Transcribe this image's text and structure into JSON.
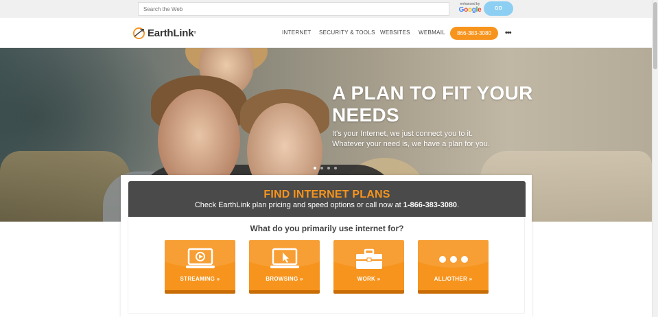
{
  "search": {
    "placeholder": "Search the Web",
    "enhanced_by": "enhanced by",
    "google": "Google",
    "go_label": "GO"
  },
  "nav": {
    "logo_text": "EarthLink",
    "links": [
      "INTERNET",
      "SECURITY & TOOLS",
      "WEBSITES",
      "WEBMAIL"
    ],
    "phone": "866-383-3080",
    "more": "•••"
  },
  "hero": {
    "title": "A PLAN TO FIT YOUR NEEDS",
    "subtitle_line1": "It's your Internet, we just connect you to it.",
    "subtitle_line2": "Whatever your need is, we have a plan for you.",
    "slides": 4,
    "active_slide": 1
  },
  "plans": {
    "title": "FIND INTERNET PLANS",
    "subtitle_prefix": "Check EarthLink plan pricing and speed options or call now at ",
    "subtitle_phone": "1-866-383-3080",
    "subtitle_suffix": ".",
    "question": "What do you primarily use internet for?",
    "tiles": [
      {
        "label": "STREAMING »",
        "icon": "monitor-play-icon"
      },
      {
        "label": "BROWSING »",
        "icon": "monitor-cursor-icon"
      },
      {
        "label": "WORK »",
        "icon": "briefcase-icon"
      },
      {
        "label": "ALL/OTHER »",
        "icon": "three-dots-icon"
      }
    ]
  },
  "colors": {
    "accent": "#f7941d",
    "go_button": "#8dcff2",
    "banner_dark": "#4a4a4a"
  }
}
